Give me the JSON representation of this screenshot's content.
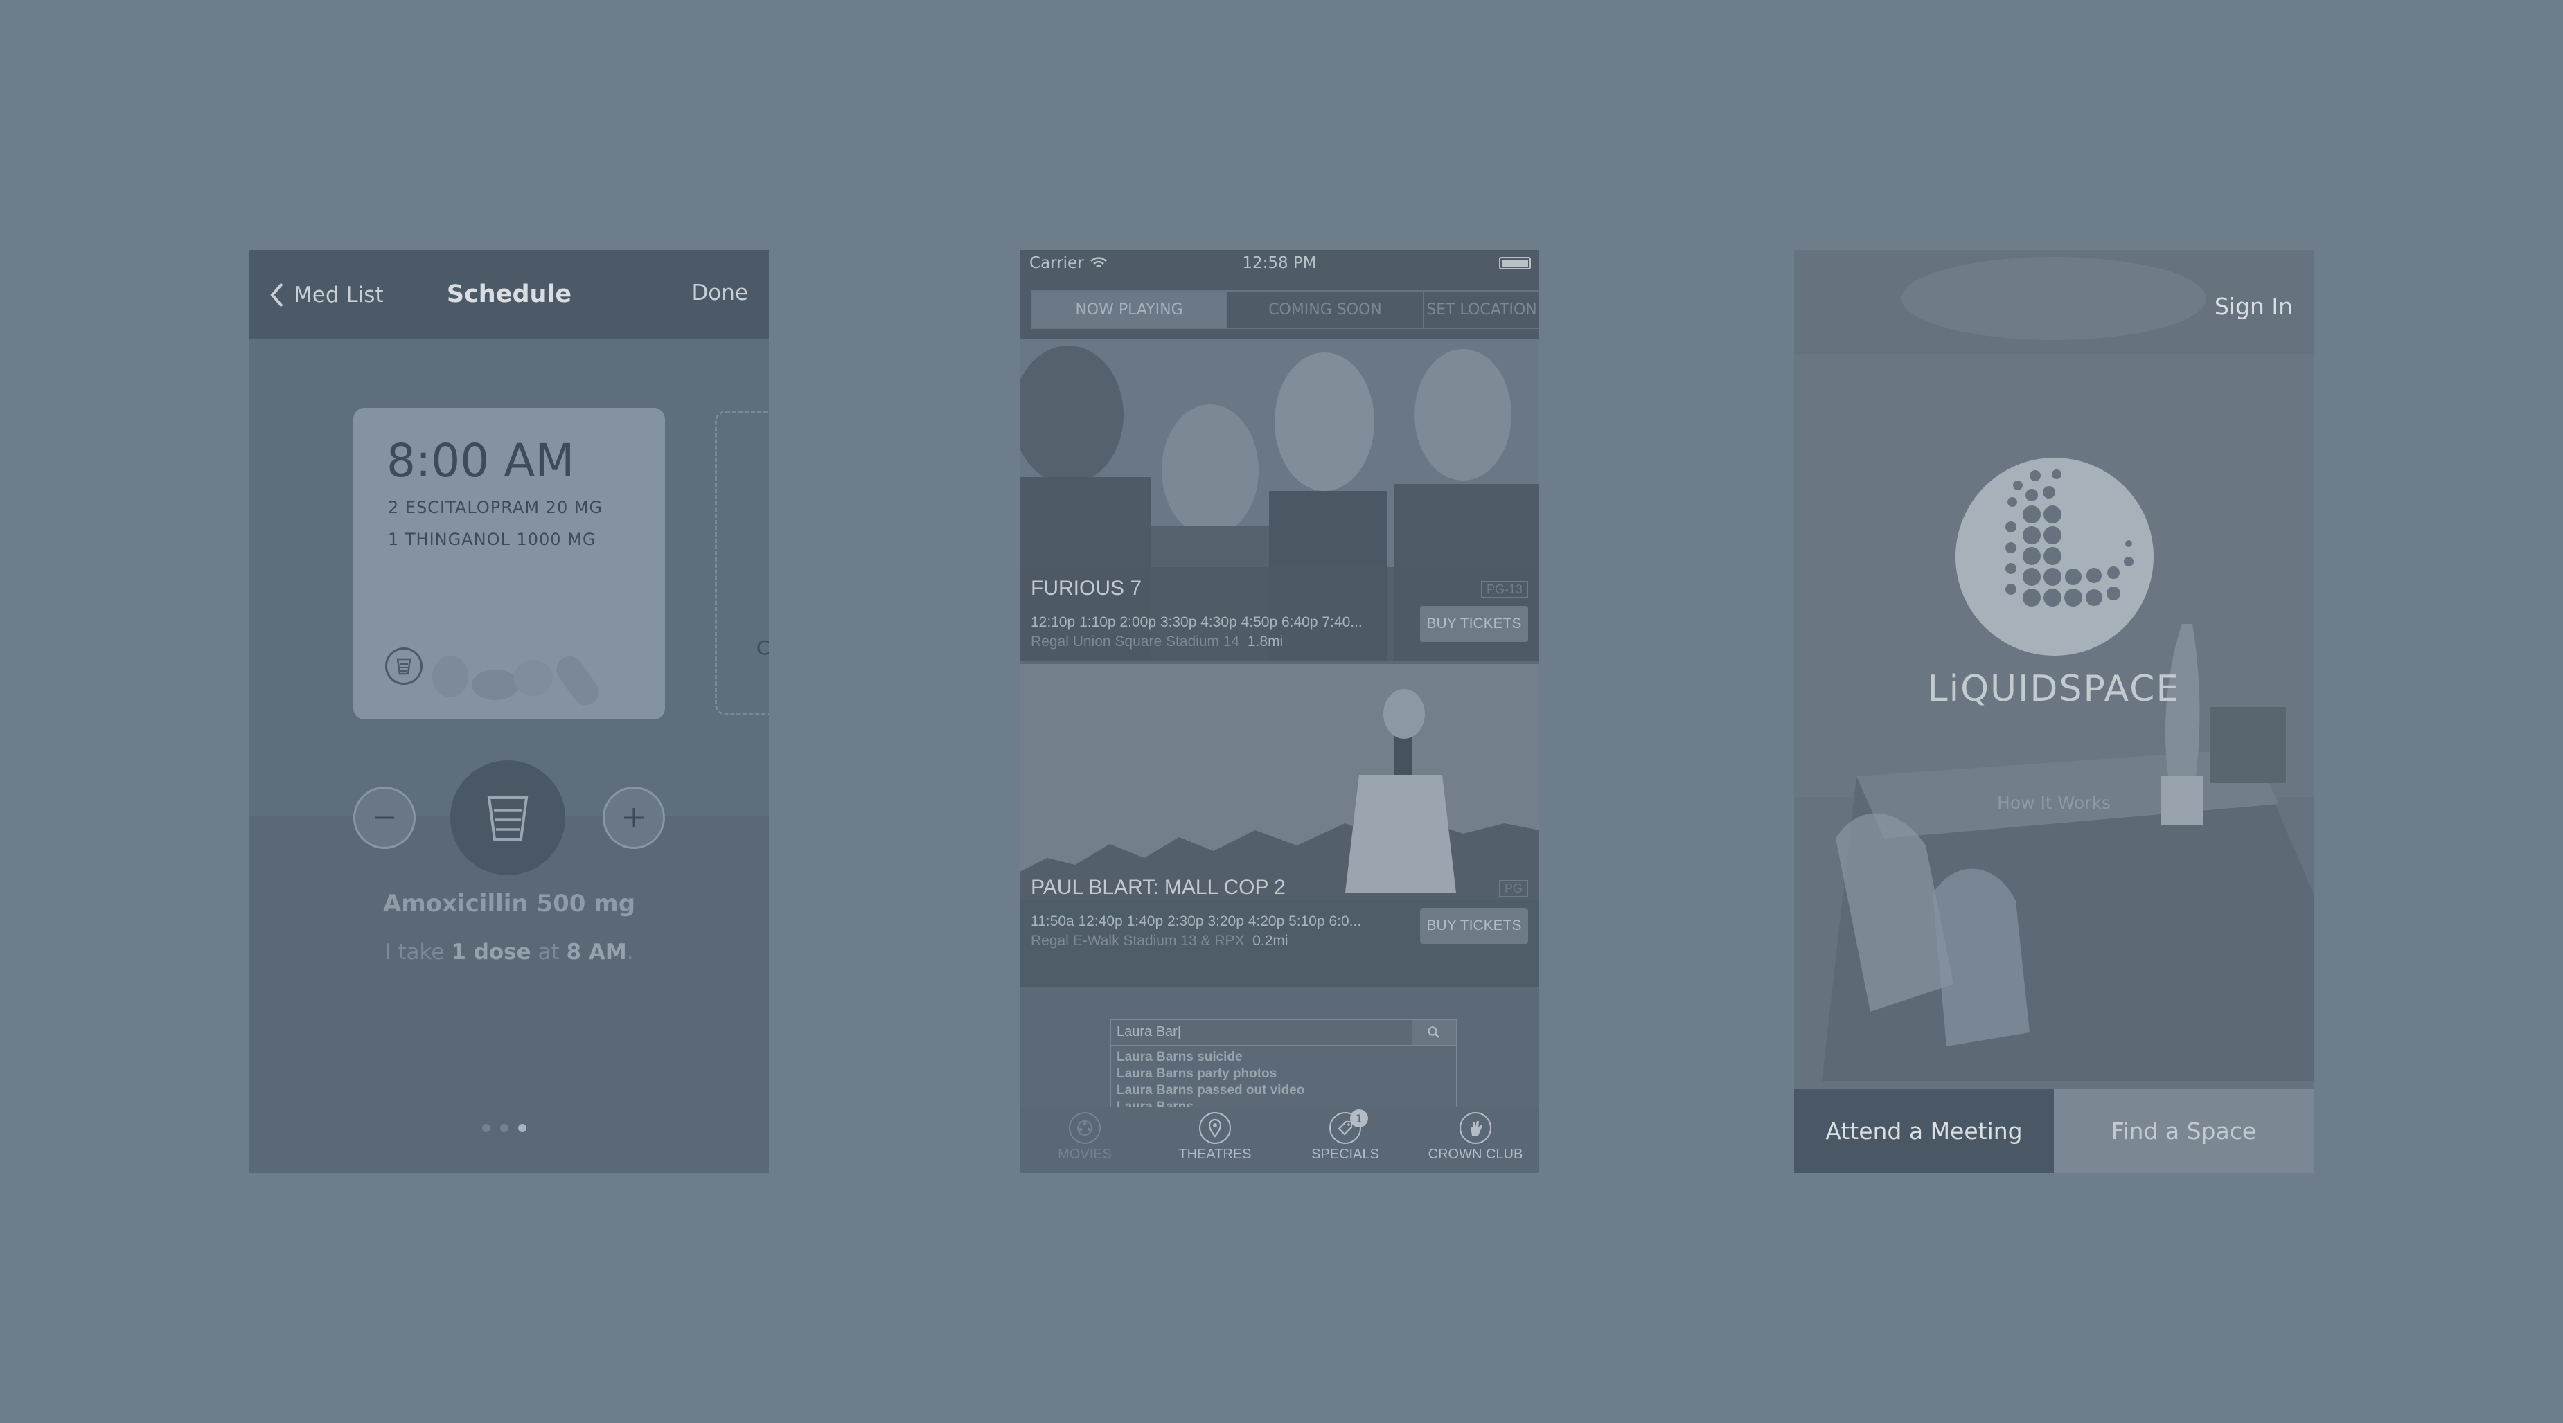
{
  "med_app": {
    "nav": {
      "back_label": "Med List",
      "title": "Schedule",
      "done_label": "Done"
    },
    "card": {
      "time": "8:00 AM",
      "lines": [
        "2 ESCITALOPRAM 20 MG",
        "1 THINGANOL 1000 MG"
      ]
    },
    "next_card_letter": "C",
    "medication": "Amoxicillin 500 mg",
    "dose": {
      "prefix": "I take ",
      "amount": "1 dose",
      "middle": " at ",
      "time": "8 AM",
      "suffix": "."
    },
    "page_dots": {
      "count": 3,
      "active": 3
    }
  },
  "movie_app": {
    "status": {
      "carrier": "Carrier",
      "time": "12:58 PM"
    },
    "segments": [
      "NOW PLAYING",
      "COMING SOON",
      "SET LOCATION"
    ],
    "movies": [
      {
        "title": "FURIOUS 7",
        "rating": "PG-13",
        "times": "12:10p 1:10p 2:00p 3:30p 4:30p 4:50p 6:40p 7:40...",
        "theatre": "Regal Union Square Stadium 14",
        "distance": "1.8mi",
        "buy_label": "BUY TICKETS"
      },
      {
        "title": "PAUL BLART: MALL COP 2",
        "rating": "PG",
        "times": "11:50a 12:40p 1:40p 2:30p 3:20p 4:20p 5:10p 6:0...",
        "theatre": "Regal E-Walk Stadium 13 & RPX",
        "distance": "0.2mi",
        "buy_label": "BUY TICKETS"
      }
    ],
    "search": {
      "query": "Laura Bar|",
      "suggestions": [
        "Laura Barns suicide",
        "Laura Barns party photos",
        "Laura Barns passed out video",
        "Laura Barns"
      ]
    },
    "tabs": [
      {
        "label": "MOVIES"
      },
      {
        "label": "THEATRES"
      },
      {
        "label": "SPECIALS",
        "badge": "1"
      },
      {
        "label": "CROWN CLUB"
      }
    ]
  },
  "space_app": {
    "sign_in": "Sign In",
    "brand": "LiQUIDSPACE",
    "how_it_works": "How It Works",
    "buttons": {
      "attend": "Attend a Meeting",
      "find": "Find a Space"
    }
  }
}
